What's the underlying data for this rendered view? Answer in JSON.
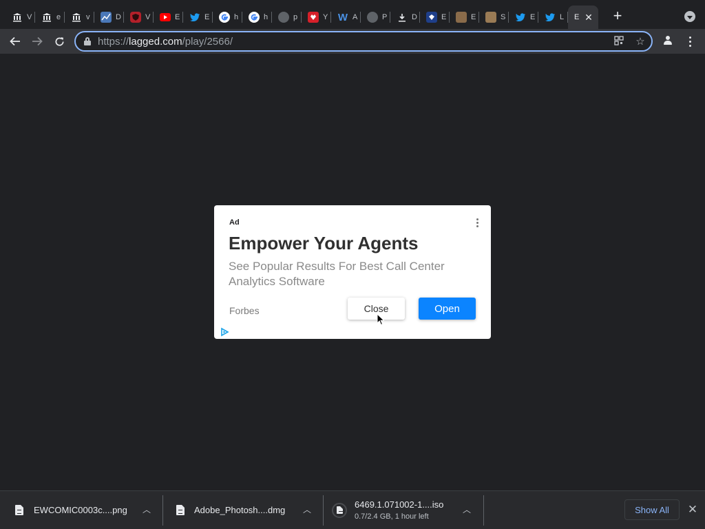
{
  "browser": {
    "tabs": [
      {
        "favicon": "museum-icon",
        "title": "V"
      },
      {
        "favicon": "museum-icon",
        "title": "e"
      },
      {
        "favicon": "museum-icon",
        "title": "v"
      },
      {
        "favicon": "chart-icon",
        "title": "D"
      },
      {
        "favicon": "shield-icon",
        "title": "V"
      },
      {
        "favicon": "youtube-icon",
        "title": "E"
      },
      {
        "favicon": "twitter-icon",
        "title": "E"
      },
      {
        "favicon": "google-icon",
        "title": "h"
      },
      {
        "favicon": "google-icon",
        "title": "h"
      },
      {
        "favicon": "globe-icon",
        "title": "p"
      },
      {
        "favicon": "heart-icon",
        "title": "Y"
      },
      {
        "favicon": "w-icon",
        "title": "A"
      },
      {
        "favicon": "globe-icon",
        "title": "P"
      },
      {
        "favicon": "download-icon",
        "title": "D"
      },
      {
        "favicon": "badge-icon",
        "title": "E"
      },
      {
        "favicon": "photo-icon",
        "title": "E"
      },
      {
        "favicon": "photo-icon",
        "title": "S"
      },
      {
        "favicon": "twitter-icon",
        "title": "E"
      },
      {
        "favicon": "twitter-icon",
        "title": "L"
      },
      {
        "favicon": "",
        "title": "E"
      }
    ],
    "active_tab_index": 19,
    "new_tab_label": "+",
    "url": {
      "scheme": "https://",
      "host": "lagged.com",
      "path": "/play/2566/"
    }
  },
  "ad": {
    "label": "Ad",
    "title": "Empower Your Agents",
    "subtitle": "See Popular Results For Best Call Center Analytics Software",
    "source": "Forbes",
    "close_label": "Close",
    "open_label": "Open",
    "open_color": "#0b84ff"
  },
  "downloads": [
    {
      "name": "EWCOMIC0003c....png",
      "status": ""
    },
    {
      "name": "Adobe_Photosh....dmg",
      "status": ""
    },
    {
      "name": "6469.1.071002-1....iso",
      "status": "0.7/2.4 GB, 1 hour left"
    }
  ],
  "shelf": {
    "show_all_label": "Show All"
  },
  "colors": {
    "accent": "#8ab4f8",
    "background": "#202124"
  }
}
